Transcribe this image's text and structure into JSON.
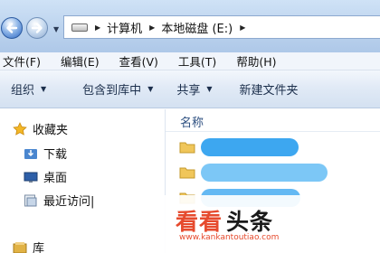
{
  "address_bar": {
    "breadcrumbs": [
      "计算机",
      "本地磁盘 (E:)"
    ]
  },
  "menu": {
    "items": [
      "文件(F)",
      "编辑(E)",
      "查看(V)",
      "工具(T)",
      "帮助(H)"
    ]
  },
  "command_bar": {
    "organize": "组织",
    "include_in_library": "包含到库中",
    "share": "共享",
    "new_folder": "新建文件夹"
  },
  "navigation": {
    "favorites": "收藏夹",
    "downloads": "下载",
    "desktop": "桌面",
    "recent_places": "最近访问|",
    "libraries": "库"
  },
  "content": {
    "column_name": "名称"
  },
  "watermark": {
    "brand_colored": "看看",
    "brand_dark": "头条",
    "url": "www.kankantoutiao.com"
  },
  "colors": {
    "accent": "#2d67c2",
    "watermark_red": "#e64a2d",
    "blurred_filename": "#3da7f0"
  },
  "icons": [
    "back-arrow-icon",
    "forward-arrow-icon",
    "drive-icon",
    "star-icon",
    "download-folder-icon",
    "desktop-icon",
    "recent-places-icon",
    "library-icon",
    "folder-icon"
  ]
}
